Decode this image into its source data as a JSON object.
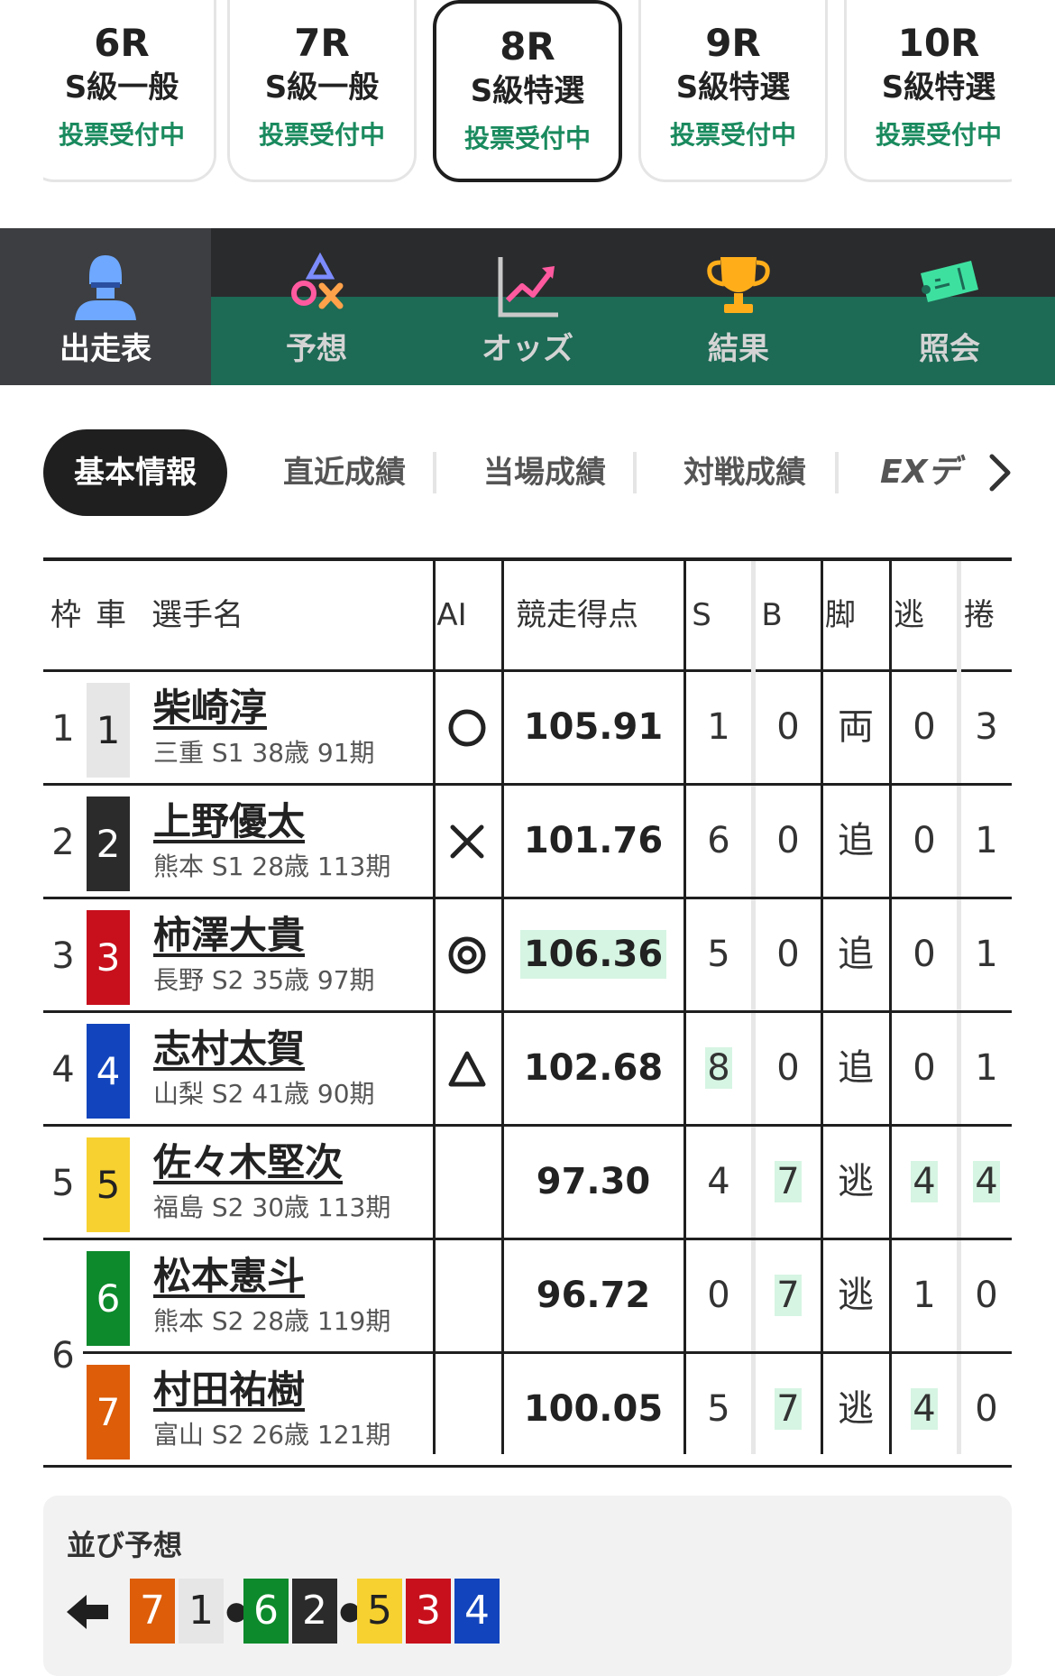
{
  "races": [
    {
      "num": "6R",
      "class": "S級一般",
      "status": "投票受付中",
      "active": false
    },
    {
      "num": "7R",
      "class": "S級一般",
      "status": "投票受付中",
      "active": false
    },
    {
      "num": "8R",
      "class": "S級特選",
      "status": "投票受付中",
      "active": true
    },
    {
      "num": "9R",
      "class": "S級特選",
      "status": "投票受付中",
      "active": false
    },
    {
      "num": "10R",
      "class": "S級特選",
      "status": "投票受付中",
      "active": false
    }
  ],
  "nav": [
    {
      "label": "出走表",
      "icon": "racer-helmet-icon"
    },
    {
      "label": "予想",
      "icon": "prediction-shapes-icon"
    },
    {
      "label": "オッズ",
      "icon": "odds-chart-icon"
    },
    {
      "label": "結果",
      "icon": "trophy-icon"
    },
    {
      "label": "照会",
      "icon": "ticket-icon"
    }
  ],
  "subtabs": [
    "基本情報",
    "直近成績",
    "当場成績",
    "対戦成績"
  ],
  "subtab_ext": "EXデ",
  "headers": {
    "waku": "枠",
    "car": "車",
    "name": "選手名",
    "ai": "AI",
    "score": "競走得点",
    "s": "S",
    "b": "B",
    "leg": "脚",
    "nige": "逃",
    "makuri": "捲"
  },
  "colors": {
    "car1": "#e6e6e6",
    "car2": "#2b2b2b",
    "car3": "#c7101c",
    "car4": "#1245bd",
    "car5": "#f7d130",
    "car6": "#0d8a2c",
    "car7": "#dd5d09",
    "accent": "#1d6a55",
    "highlight": "#d6f5e3"
  },
  "riders": [
    {
      "waku": "1",
      "car": "1",
      "name": "柴崎淳",
      "info": "三重 S1 38歳 91期",
      "ai": "circle",
      "score": "105.91",
      "s": "1",
      "b": "0",
      "leg": "両",
      "nige": "0",
      "makuri": "3"
    },
    {
      "waku": "2",
      "car": "2",
      "name": "上野優太",
      "info": "熊本 S1 28歳 113期",
      "ai": "cross",
      "score": "101.76",
      "s": "6",
      "b": "0",
      "leg": "追",
      "nige": "0",
      "makuri": "1"
    },
    {
      "waku": "3",
      "car": "3",
      "name": "柿澤大貴",
      "info": "長野 S2 35歳 97期",
      "ai": "double-circle",
      "score": "106.36",
      "s": "5",
      "b": "0",
      "leg": "追",
      "nige": "0",
      "makuri": "1"
    },
    {
      "waku": "4",
      "car": "4",
      "name": "志村太賀",
      "info": "山梨 S2 41歳 90期",
      "ai": "triangle",
      "score": "102.68",
      "s": "8",
      "b": "0",
      "leg": "追",
      "nige": "0",
      "makuri": "1"
    },
    {
      "waku": "5",
      "car": "5",
      "name": "佐々木堅次",
      "info": "福島 S2 30歳 113期",
      "ai": "",
      "score": "97.30",
      "s": "4",
      "b": "7",
      "leg": "逃",
      "nige": "4",
      "makuri": "4"
    },
    {
      "waku": "6",
      "car": "6",
      "name": "松本憲斗",
      "info": "熊本 S2 28歳 119期",
      "ai": "",
      "score": "96.72",
      "s": "0",
      "b": "7",
      "leg": "逃",
      "nige": "1",
      "makuri": "0"
    },
    {
      "waku": "",
      "car": "7",
      "name": "村田祐樹",
      "info": "富山 S2 26歳 121期",
      "ai": "",
      "score": "100.05",
      "s": "5",
      "b": "7",
      "leg": "逃",
      "nige": "4",
      "makuri": "0"
    }
  ],
  "waku6_label": "6",
  "narabi": {
    "title": "並び予想",
    "sequence": [
      "7",
      "1",
      "6",
      "2",
      "5",
      "3",
      "4"
    ]
  }
}
